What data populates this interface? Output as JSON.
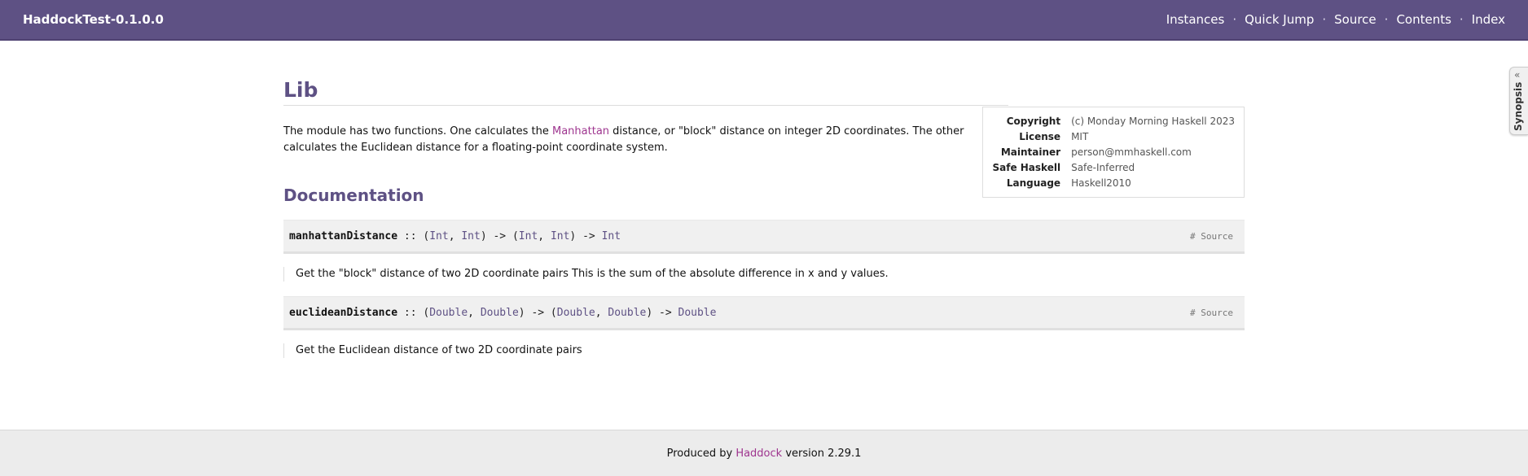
{
  "header": {
    "package_caption": "HaddockTest-0.1.0.0",
    "menu": [
      "Instances",
      "Quick Jump",
      "Source",
      "Contents",
      "Index"
    ],
    "separator": "·"
  },
  "module": {
    "title": "Lib",
    "info": [
      {
        "key": "Copyright",
        "value": "(c) Monday Morning Haskell 2023"
      },
      {
        "key": "License",
        "value": "MIT"
      },
      {
        "key": "Maintainer",
        "value": "person@mmhaskell.com"
      },
      {
        "key": "Safe Haskell",
        "value": "Safe-Inferred"
      },
      {
        "key": "Language",
        "value": "Haskell2010"
      }
    ],
    "description": {
      "part1": "The module has two functions. One calculates the ",
      "link": "Manhattan",
      "part2": " distance, or \"block\" distance on integer 2D coordinates. The other calculates the Euclidean distance for a floating-point coordinate system."
    }
  },
  "documentation": {
    "heading": "Documentation",
    "functions": [
      {
        "name": "manhattanDistance",
        "sig": {
          "dc": " :: ",
          "p1": "(",
          "t1": "Int",
          "c1": ", ",
          "t2": "Int",
          "p2": ") -> (",
          "t3": "Int",
          "c2": ", ",
          "t4": "Int",
          "p3": ") -> ",
          "t5": "Int"
        },
        "anchor": "#",
        "source": "Source",
        "doc": "Get the \"block\" distance of two 2D coordinate pairs This is the sum of the absolute difference in x and y values."
      },
      {
        "name": "euclideanDistance",
        "sig": {
          "dc": " :: ",
          "p1": "(",
          "t1": "Double",
          "c1": ", ",
          "t2": "Double",
          "p2": ") -> (",
          "t3": "Double",
          "c2": ", ",
          "t4": "Double",
          "p3": ") -> ",
          "t5": "Double"
        },
        "anchor": "#",
        "source": "Source",
        "doc": "Get the Euclidean distance of two 2D coordinate pairs"
      }
    ]
  },
  "footer": {
    "prefix": "Produced by ",
    "link": "Haddock",
    "suffix": " version 2.29.1"
  },
  "synopsis": {
    "label": "Synopsis",
    "icon": "double-chevron-left-icon"
  }
}
